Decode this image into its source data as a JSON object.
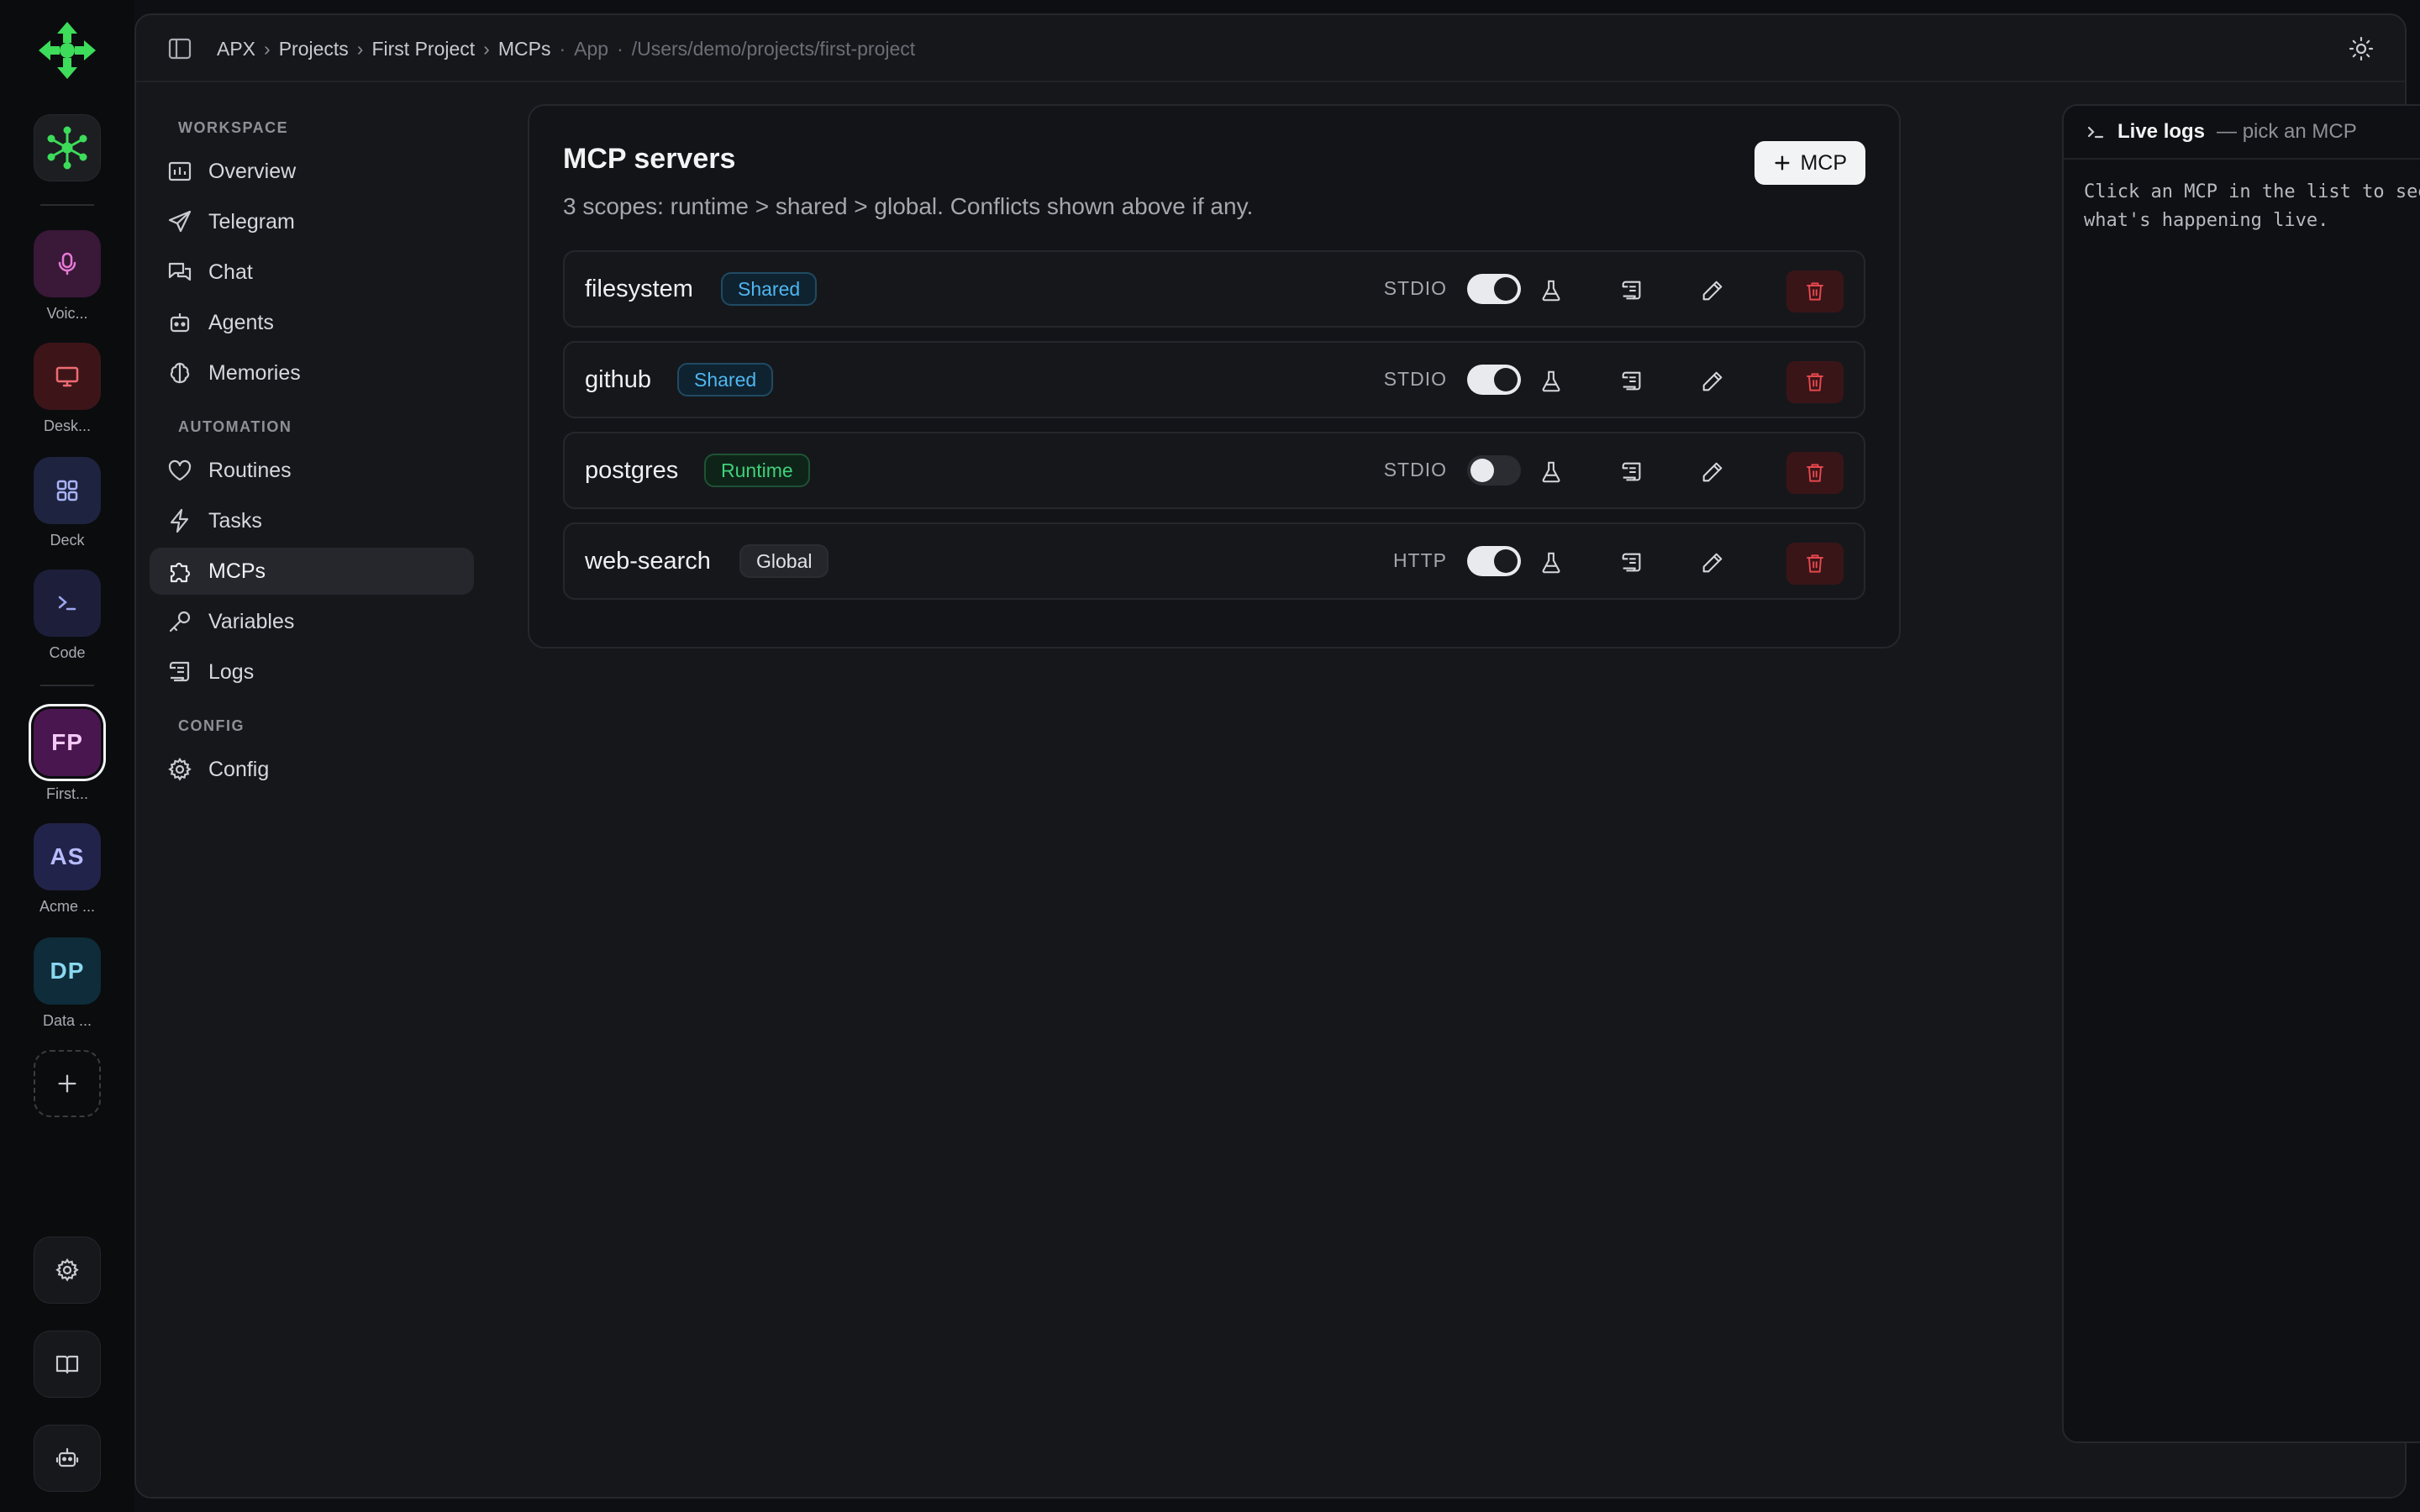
{
  "rail": {
    "apps": [
      {
        "label": "Voic...",
        "icon": "microphone-icon",
        "bg": "#3a1838",
        "fg": "#e67ad6"
      },
      {
        "label": "Desk...",
        "icon": "monitor-icon",
        "bg": "#3d1519",
        "fg": "#ef6b73"
      },
      {
        "label": "Deck",
        "icon": "grid-icon",
        "bg": "#1e2340",
        "fg": "#a9b4f5"
      },
      {
        "label": "Code",
        "icon": "terminal-icon",
        "bg": "#1d1f3a",
        "fg": "#9fa7f0"
      }
    ],
    "projects": [
      {
        "initials": "FP",
        "label": "First...",
        "bg": "#4a1650",
        "fg": "#f2c8f4"
      },
      {
        "initials": "AS",
        "label": "Acme ...",
        "bg": "#22234a",
        "fg": "#b8bcff"
      },
      {
        "initials": "DP",
        "label": "Data ...",
        "bg": "#0e2c3a",
        "fg": "#8ad7f0"
      }
    ]
  },
  "breadcrumb": {
    "items": [
      "APX",
      "Projects",
      "First Project",
      "MCPs"
    ],
    "app": "App",
    "path": "/Users/demo/projects/first-project"
  },
  "nav": {
    "workspace_label": "WORKSPACE",
    "automation_label": "AUTOMATION",
    "config_label": "CONFIG",
    "workspace": [
      "Overview",
      "Telegram",
      "Chat",
      "Agents",
      "Memories"
    ],
    "automation": [
      "Routines",
      "Tasks",
      "MCPs",
      "Variables",
      "Logs"
    ],
    "config": [
      "Config"
    ],
    "active": "MCPs"
  },
  "mcp": {
    "title": "MCP servers",
    "subtitle": "3 scopes: runtime > shared > global. Conflicts shown above if any.",
    "add_label": "MCP",
    "servers": [
      {
        "name": "filesystem",
        "scope": "Shared",
        "transport": "STDIO",
        "enabled": true
      },
      {
        "name": "github",
        "scope": "Shared",
        "transport": "STDIO",
        "enabled": true
      },
      {
        "name": "postgres",
        "scope": "Runtime",
        "transport": "STDIO",
        "enabled": false
      },
      {
        "name": "web-search",
        "scope": "Global",
        "transport": "HTTP",
        "enabled": true
      }
    ]
  },
  "logs": {
    "title": "Live logs",
    "subtitle": "— pick an MCP",
    "empty_line1": "Click an MCP in the list to see",
    "empty_line2": "what's happening live."
  },
  "colors": {
    "accent_green": "#3ddc5a",
    "danger": "#e5484d"
  }
}
